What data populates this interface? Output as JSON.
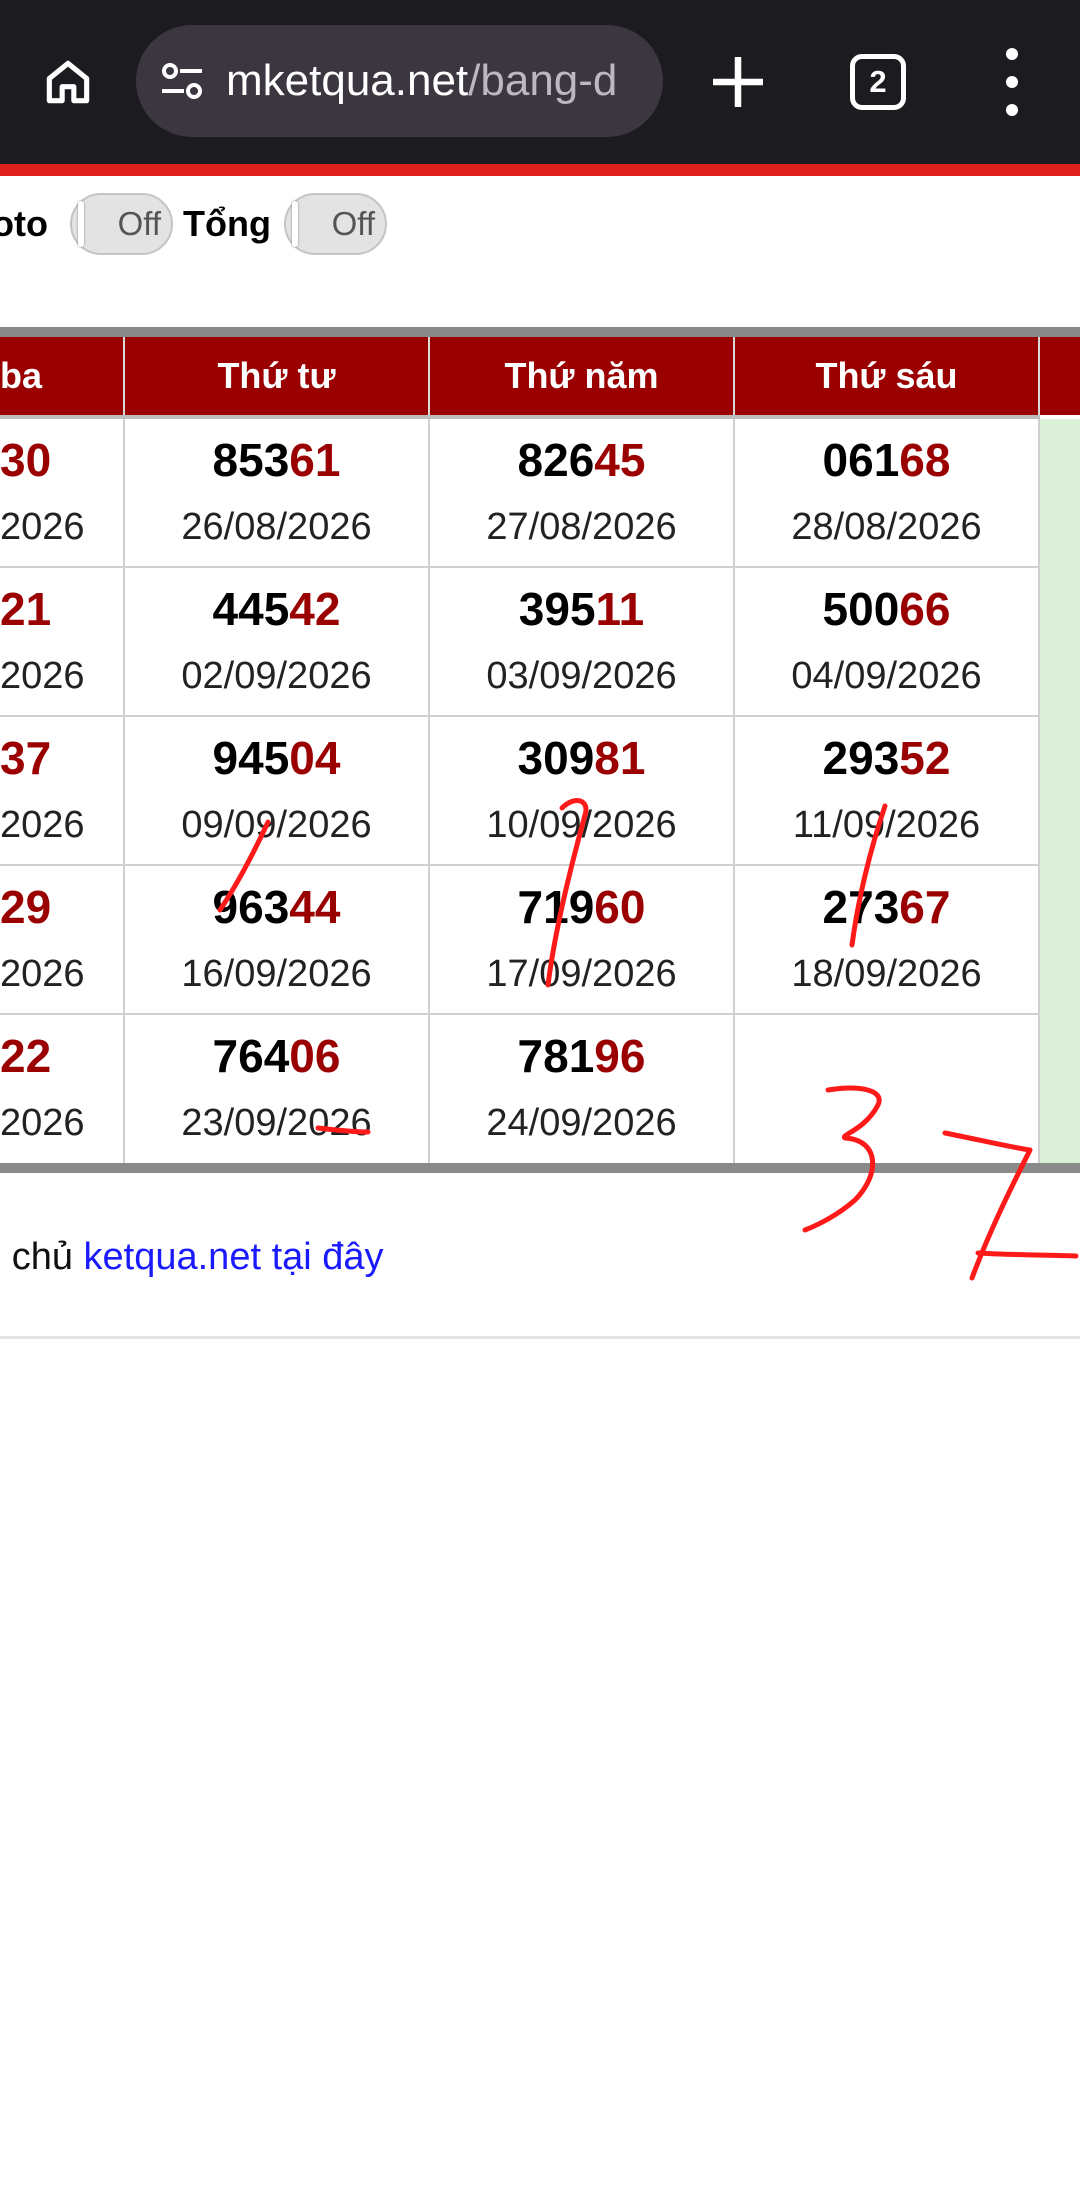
{
  "browser": {
    "url_host": "mketqua.net",
    "url_path": "/bang-d",
    "tab_count": "2"
  },
  "toggles": [
    {
      "label": "oto",
      "state": "Off"
    },
    {
      "label": "Tổng",
      "state": "Off"
    }
  ],
  "table": {
    "headers": [
      "ba",
      "Thứ tư",
      "Thứ năm",
      "Thứ sáu",
      ""
    ],
    "rows": [
      [
        {
          "head": "",
          "tail": "30",
          "date": "2026"
        },
        {
          "head": "853",
          "tail": "61",
          "date": "26/08/2026"
        },
        {
          "head": "826",
          "tail": "45",
          "date": "27/08/2026"
        },
        {
          "head": "061",
          "tail": "68",
          "date": "28/08/2026"
        }
      ],
      [
        {
          "head": "",
          "tail": "21",
          "date": "2026"
        },
        {
          "head": "445",
          "tail": "42",
          "date": "02/09/2026"
        },
        {
          "head": "395",
          "tail": "11",
          "date": "03/09/2026"
        },
        {
          "head": "500",
          "tail": "66",
          "date": "04/09/2026"
        }
      ],
      [
        {
          "head": "",
          "tail": "37",
          "date": "2026"
        },
        {
          "head": "945",
          "tail": "04",
          "date": "09/09/2026"
        },
        {
          "head": "309",
          "tail": "81",
          "date": "10/09/2026"
        },
        {
          "head": "293",
          "tail": "52",
          "date": "11/09/2026"
        }
      ],
      [
        {
          "head": "",
          "tail": "29",
          "date": "2026"
        },
        {
          "head": "963",
          "tail": "44",
          "date": "16/09/2026"
        },
        {
          "head": "719",
          "tail": "60",
          "date": "17/09/2026"
        },
        {
          "head": "273",
          "tail": "67",
          "date": "18/09/2026"
        }
      ],
      [
        {
          "head": "",
          "tail": "22",
          "date": "2026"
        },
        {
          "head": "764",
          "tail": "06",
          "date": "23/09/2026"
        },
        {
          "head": "781",
          "tail": "96",
          "date": "24/09/2026"
        },
        {
          "head": "",
          "tail": "",
          "date": ""
        }
      ]
    ]
  },
  "footer": {
    "prefix": "g chủ ",
    "link_text": "ketqua.net tại đây"
  },
  "handwriting": "37",
  "colors": {
    "topbar": "#1c1b1f",
    "accent_red_line": "#e0201c",
    "header_bg": "#9b0000",
    "number_tail": "#9b0000",
    "green_column": "#dcefd8",
    "link": "#1a1aff",
    "scribble": "#ff1a1a"
  }
}
